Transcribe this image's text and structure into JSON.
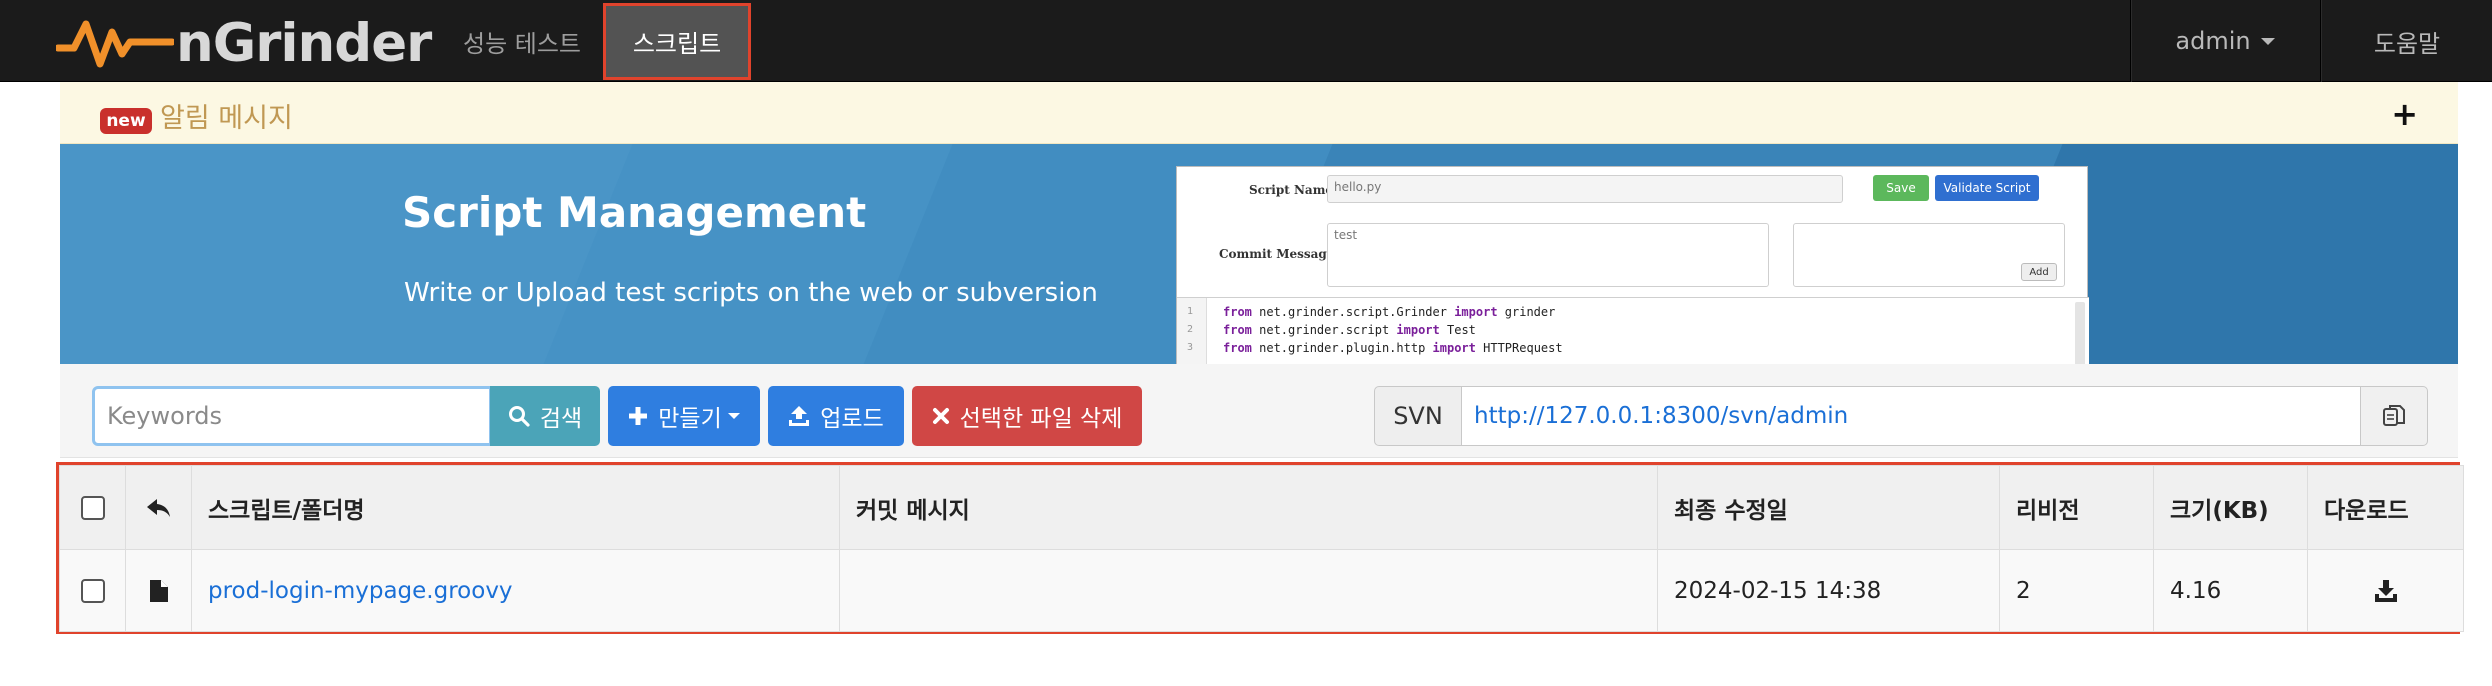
{
  "navbar": {
    "brand": "nGrinder",
    "perf_test": "성능 테스트",
    "script": "스크립트",
    "admin": "admin",
    "help": "도움말"
  },
  "alert": {
    "badge": "new",
    "title": "알림 메시지",
    "toggle": "+"
  },
  "banner": {
    "title": "Script Management",
    "subtitle": "Write or Upload test scripts on the web or subversion",
    "mock": {
      "script_name_label": "Script Name",
      "script_name_value": "hello.py",
      "save": "Save",
      "validate": "Validate Script",
      "commit_label": "Commit Message",
      "commit_value": "test",
      "add": "Add",
      "code_lines": [
        {
          "num": "1",
          "kw1": "from",
          "mod": " net.grinder.script.Grinder ",
          "kw2": "import",
          "name": " grinder"
        },
        {
          "num": "2",
          "kw1": "from",
          "mod": " net.grinder.script ",
          "kw2": "import",
          "name": " Test"
        },
        {
          "num": "3",
          "kw1": "from",
          "mod": " net.grinder.plugin.http ",
          "kw2": "import",
          "name": " HTTPRequest"
        }
      ]
    }
  },
  "toolbar": {
    "search_placeholder": "Keywords",
    "search": "검색",
    "create": "만들기",
    "upload": "업로드",
    "delete": "선택한 파일 삭제",
    "svn_label": "SVN",
    "svn_url": "http://127.0.0.1:8300/svn/admin"
  },
  "table": {
    "headers": {
      "name": "스크립트/폴더명",
      "commit": "커밋 메시지",
      "modified": "최종 수정일",
      "revision": "리비전",
      "size": "크기(KB)",
      "download": "다운로드"
    },
    "rows": [
      {
        "name": "prod-login-mypage.groovy",
        "commit": "",
        "modified": "2024-02-15 14:38",
        "revision": "2",
        "size": "4.16"
      }
    ]
  },
  "colors": {
    "navbar_bg": "#1b1b1b",
    "active_highlight": "#e0432c",
    "primary": "#2f7ee0",
    "info": "#4ba4b8",
    "danger": "#d04745",
    "link": "#1a6fd6",
    "brand_orange": "#f0902a"
  },
  "icons": {
    "search": "search-icon",
    "create": "plus-icon",
    "upload": "upload-icon",
    "delete": "x-icon",
    "copy": "copy-icon",
    "parent": "reply-arrow-icon",
    "file": "file-icon",
    "download": "download-icon"
  }
}
